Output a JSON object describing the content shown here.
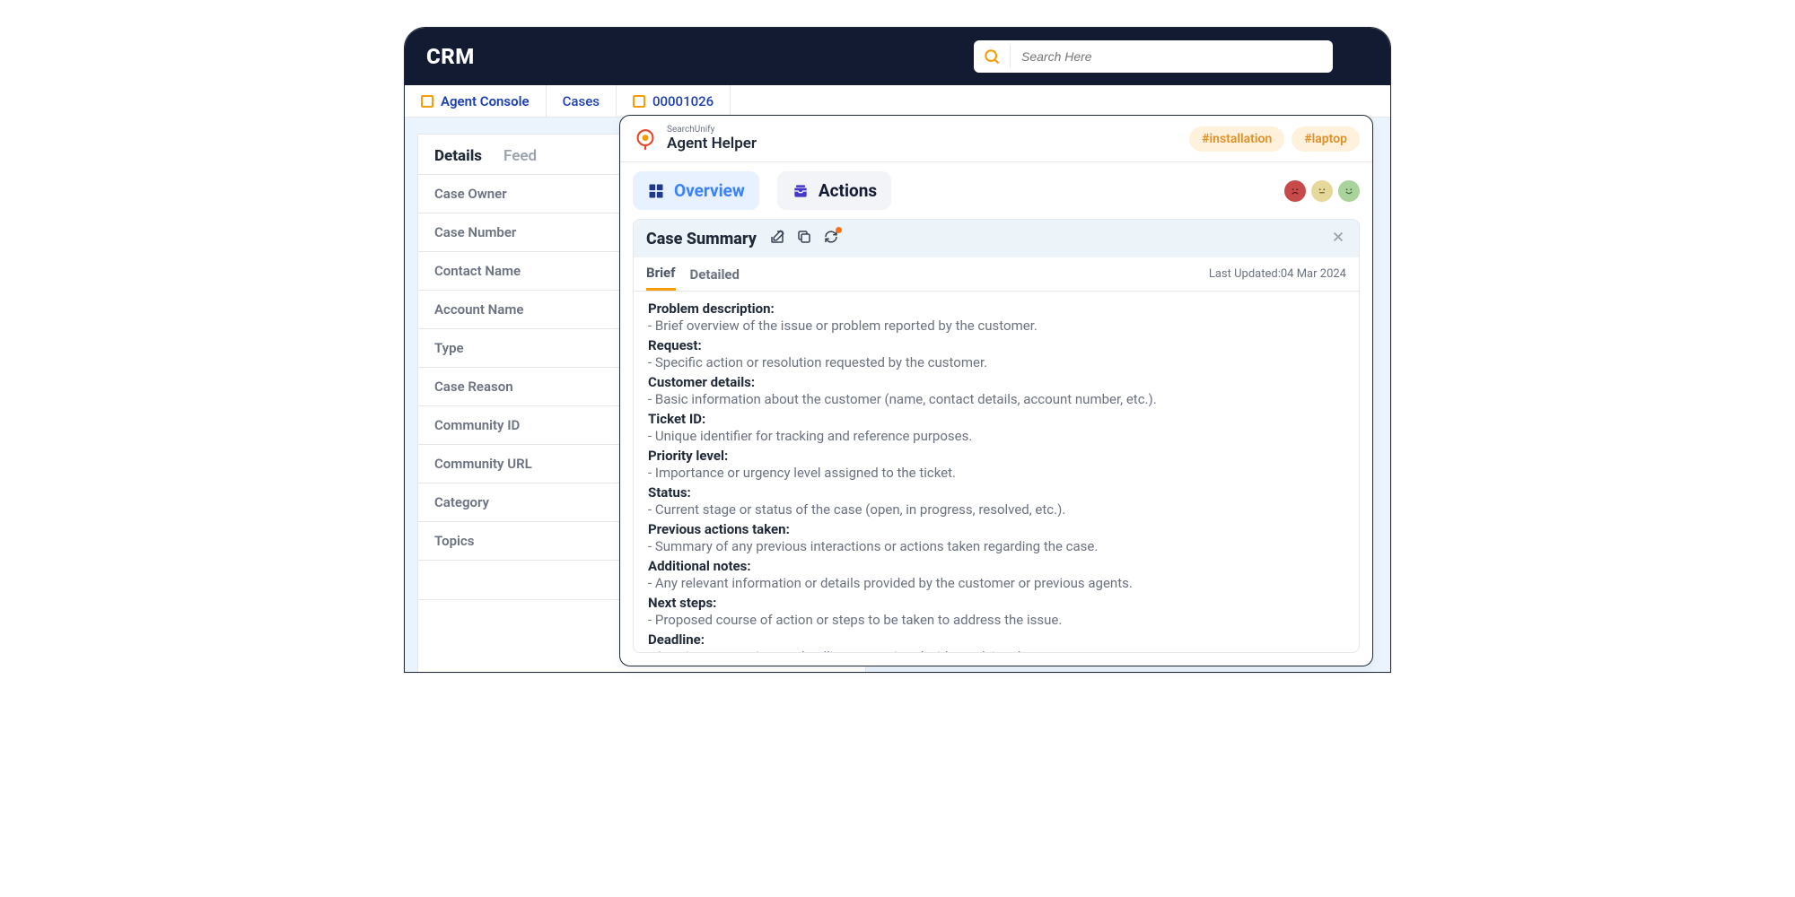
{
  "crm": {
    "title": "CRM",
    "search_placeholder": "Search Here",
    "tabs": [
      {
        "label": "Agent Console",
        "icon": "tab-icon"
      },
      {
        "label": "Cases",
        "icon": "tab-icon"
      },
      {
        "label": "00001026",
        "icon": "tab-icon"
      }
    ]
  },
  "details": {
    "subtabs": {
      "active": "Details",
      "inactive": "Feed"
    },
    "rows": [
      "Case Owner",
      "Case Number",
      "Contact Name",
      "Account Name",
      "Type",
      "Case Reason",
      "Community ID",
      "Community URL",
      "Category",
      "Topics"
    ]
  },
  "helper": {
    "brand": "SearchUnify",
    "name": "Agent Helper",
    "tags": [
      "#installation",
      "#laptop"
    ],
    "tabs": {
      "overview": "Overview",
      "actions": "Actions"
    },
    "summary": {
      "title": "Case Summary",
      "tabs": {
        "brief": "Brief",
        "detailed": "Detailed"
      },
      "last_updated_label": "Last Updated:",
      "last_updated_value": "04 Mar 2024",
      "sections": [
        {
          "title": "Problem description:",
          "text": "- Brief overview of the issue or problem reported by the customer."
        },
        {
          "title": "Request:",
          "text": "- Specific action or resolution requested by the customer."
        },
        {
          "title": "Customer details:",
          "text": "- Basic information about the customer (name, contact details, account number, etc.)."
        },
        {
          "title": "Ticket ID:",
          "text": "- Unique identifier for tracking and reference purposes."
        },
        {
          "title": "Priority level:",
          "text": "- Importance or urgency level assigned to the ticket."
        },
        {
          "title": "Status:",
          "text": "- Current stage or status of the case (open, in progress, resolved, etc.)."
        },
        {
          "title": "Previous actions taken:",
          "text": "- Summary of any previous interactions or actions taken regarding the case."
        },
        {
          "title": "Additional notes:",
          "text": "- Any relevant information or details provided by the customer or previous agents."
        },
        {
          "title": "Next steps:",
          "text": "- Proposed course of action or steps to be taken to address the issue."
        },
        {
          "title": "Deadline:",
          "text": "- Any time constraints or deadlines associated with resolving the case."
        }
      ]
    }
  }
}
